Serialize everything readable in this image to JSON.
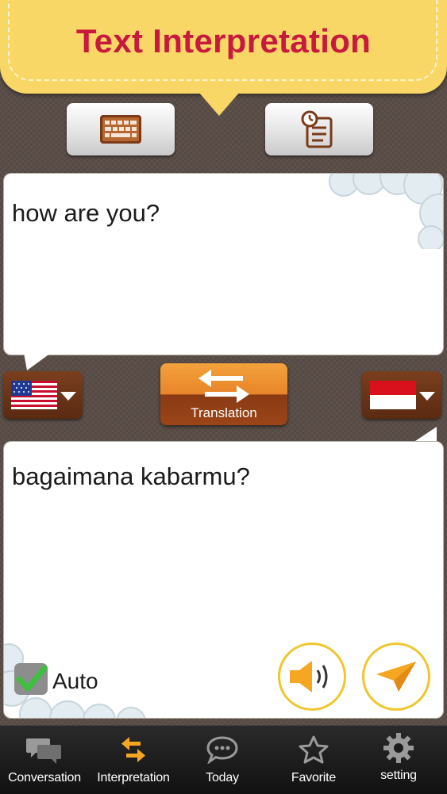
{
  "header": {
    "title": "Text Interpretation"
  },
  "toolbar": {
    "keyboard_icon": "keyboard-icon",
    "history_icon": "clipboard-clock-icon"
  },
  "source": {
    "text": "how are you?",
    "language_flag": "us-flag"
  },
  "target": {
    "text": "bagaimana kabarmu?",
    "language_flag": "indonesia-flag"
  },
  "translate_button": {
    "label": "Translation"
  },
  "auto": {
    "label": "Auto",
    "checked": true
  },
  "nav": {
    "items": [
      {
        "label": "Conversation",
        "icon": "chat-bubbles-icon"
      },
      {
        "label": "Interpretation",
        "icon": "swap-arrows-icon",
        "active": true
      },
      {
        "label": "Today",
        "icon": "speech-bubble-icon"
      },
      {
        "label": "Favorite",
        "icon": "star-icon"
      },
      {
        "label": "setting",
        "icon": "gear-icon"
      }
    ]
  },
  "colors": {
    "banner": "#f8d766",
    "title": "#c8193e",
    "accent_orange": "#e8852a",
    "ring_yellow": "#f0c62d",
    "lang_brown": "#6b3418"
  }
}
